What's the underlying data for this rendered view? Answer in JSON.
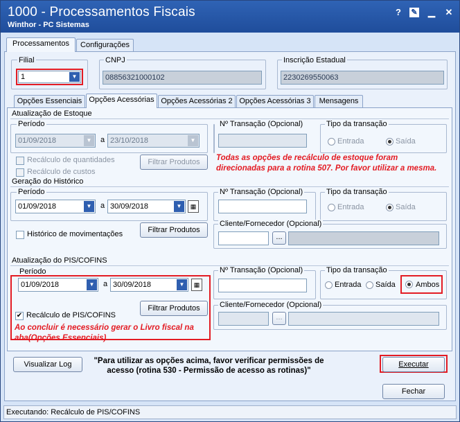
{
  "window": {
    "title": "1000 - Processamentos Fiscais",
    "subtitle": "Winthor - PC Sistemas",
    "help_btn": "?",
    "restore_btn": "✎",
    "minimize_btn": "▁",
    "close_btn": "✕"
  },
  "main_tabs": [
    "Processamentos",
    "Configurações"
  ],
  "header": {
    "filial_label": "Filial",
    "filial_value": "1",
    "cnpj_label": "CNPJ",
    "cnpj_value": "08856321000102",
    "ie_label": "Inscrição Estadual",
    "ie_value": "2230269550063"
  },
  "sub_tabs": [
    "Opções Essenciais",
    "Opções Acessórias",
    "Opções Acessórias 2",
    "Opções Acessórias 3",
    "Mensagens"
  ],
  "estoque": {
    "title": "Atualização de Estoque",
    "periodo_label": "Período",
    "date_from": "01/09/2018",
    "sep": "a",
    "date_to": "23/10/2018",
    "ntrans_label": "Nº Transação (Opcional)",
    "tipo_label": "Tipo da transação",
    "entrada": "Entrada",
    "saida": "Saída",
    "recalc_qtd": "Recálculo de quantidades",
    "recalc_custos": "Recálculo de custos",
    "filtrar": "Filtrar Produtos",
    "note": "Todas as opções de recálculo de estoque foram direcionadas para a rotina 507. Por favor utilizar a mesma."
  },
  "historico": {
    "title": "Geração do Histórico",
    "periodo_label": "Período",
    "date_from": "01/09/2018",
    "sep": "a",
    "date_to": "30/09/2018",
    "ntrans_label": "Nº Transação (Opcional)",
    "tipo_label": "Tipo da transação",
    "entrada": "Entrada",
    "saida": "Saída",
    "hist_mov": "Histórico de movimentações",
    "filtrar": "Filtrar Produtos",
    "cliente_label": "Cliente/Fornecedor (Opcional)",
    "ellipsis": "..."
  },
  "pis": {
    "title": "Atualização do PIS/COFINS",
    "periodo_label": "Período",
    "date_from": "01/09/2018",
    "sep": "a",
    "date_to": "30/09/2018",
    "ntrans_label": "Nº Transação (Opcional)",
    "tipo_label": "Tipo da transação",
    "entrada": "Entrada",
    "saida": "Saída",
    "ambos": "Ambos",
    "recalc": "Recálculo de PIS/COFINS",
    "filtrar": "Filtrar Produtos",
    "cliente_label": "Cliente/Fornecedor (Opcional)",
    "ellipsis": "...",
    "note": "Ao concluir é necessário gerar o Livro fiscal na aba(Opções Essenciais)"
  },
  "footer": {
    "log_btn": "Visualizar Log",
    "message": "\"Para utilizar as opções acima, favor verificar permissões de acesso (rotina 530 - Permissão de acesso as rotinas)\"",
    "executar": "Executar",
    "fechar": "Fechar"
  },
  "status": "Executando: Recálculo de PIS/COFINS",
  "colors": {
    "accent": "#1f4d9b",
    "highlight": "#e31b23"
  }
}
